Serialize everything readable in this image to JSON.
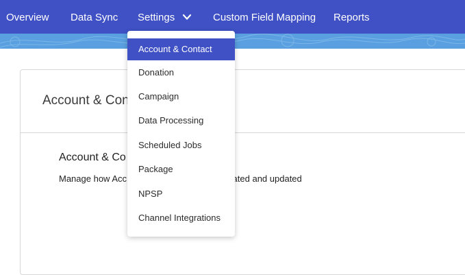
{
  "nav": {
    "items": [
      {
        "label": "Overview"
      },
      {
        "label": "Data Sync"
      },
      {
        "label": "Settings"
      },
      {
        "label": "Custom Field Mapping"
      },
      {
        "label": "Reports"
      }
    ],
    "settings_chevron_icon": "chevron-down-icon"
  },
  "colors": {
    "accent": "#3f51c4",
    "band": "#5aa0e0",
    "border": "#d7d7d7"
  },
  "card": {
    "title": "Account & Con",
    "section_title": "Account & Co",
    "section_desc_left": "Manage how Acc",
    "section_desc_right": "reated and updated"
  },
  "dropdown": {
    "items": [
      {
        "label": "Account & Contact",
        "active": true
      },
      {
        "label": "Donation"
      },
      {
        "label": "Campaign"
      },
      {
        "label": "Data Processing"
      },
      {
        "label": "Scheduled Jobs"
      },
      {
        "label": "Package"
      },
      {
        "label": "NPSP"
      },
      {
        "label": "Channel Integrations"
      }
    ]
  }
}
